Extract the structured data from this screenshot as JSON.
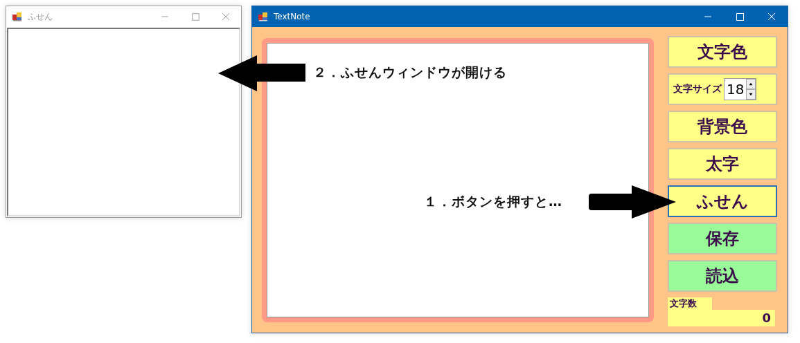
{
  "sticky_window": {
    "title": "ふせん",
    "active": false
  },
  "main_window": {
    "title": "TextNote",
    "active": true,
    "buttons": [
      {
        "label": "文字色",
        "color": "#ffff88",
        "focused": false
      },
      {
        "kind": "spinner"
      },
      {
        "label": "背景色",
        "color": "#ffff88",
        "focused": false
      },
      {
        "label": "太字",
        "color": "#ffff88",
        "focused": false
      },
      {
        "label": "ふせん",
        "color": "#ffff88",
        "focused": true
      },
      {
        "label": "保存",
        "color": "#98fb98",
        "focused": false
      },
      {
        "label": "読込",
        "color": "#98fb98",
        "focused": false
      }
    ],
    "font_size": {
      "label": "文字サイズ",
      "value": "18"
    },
    "char_count": {
      "label": "文字数",
      "value": "0"
    }
  },
  "annotations": [
    {
      "text": "２．ふせんウィンドウが開ける",
      "kind": "left"
    },
    {
      "text": "１．ボタンを押すと…",
      "kind": "right"
    }
  ]
}
